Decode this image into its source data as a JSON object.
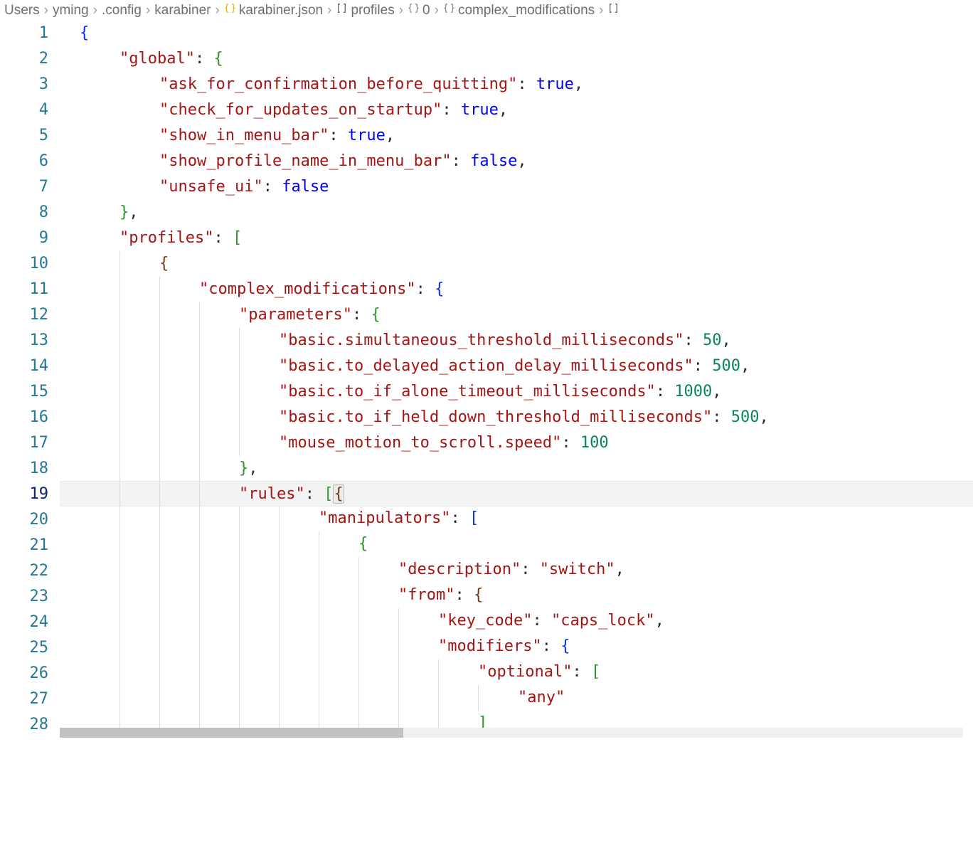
{
  "breadcrumb": [
    {
      "label": "Users",
      "icon": null
    },
    {
      "label": "yming",
      "icon": null
    },
    {
      "label": ".config",
      "icon": null
    },
    {
      "label": "karabiner",
      "icon": null
    },
    {
      "label": "karabiner.json",
      "icon": "braces-orange"
    },
    {
      "label": "profiles",
      "icon": "brackets"
    },
    {
      "label": "0",
      "icon": "braces-gray"
    },
    {
      "label": "complex_modifications",
      "icon": "braces-gray"
    },
    {
      "label": "",
      "icon": "brackets"
    }
  ],
  "active_line": 19,
  "lines": [
    {
      "n": 1,
      "indent": 0,
      "guides": [],
      "tokens": [
        [
          "bracket-b",
          "{"
        ]
      ]
    },
    {
      "n": 2,
      "indent": 1,
      "guides": [],
      "tokens": [
        [
          "key",
          "\"global\""
        ],
        [
          "punct",
          ": "
        ],
        [
          "bracket-g",
          "{"
        ]
      ]
    },
    {
      "n": 3,
      "indent": 2,
      "guides": [],
      "tokens": [
        [
          "key",
          "\"ask_for_confirmation_before_quitting\""
        ],
        [
          "punct",
          ": "
        ],
        [
          "bool",
          "true"
        ],
        [
          "punct",
          ","
        ]
      ]
    },
    {
      "n": 4,
      "indent": 2,
      "guides": [],
      "tokens": [
        [
          "key",
          "\"check_for_updates_on_startup\""
        ],
        [
          "punct",
          ": "
        ],
        [
          "bool",
          "true"
        ],
        [
          "punct",
          ","
        ]
      ]
    },
    {
      "n": 5,
      "indent": 2,
      "guides": [],
      "tokens": [
        [
          "key",
          "\"show_in_menu_bar\""
        ],
        [
          "punct",
          ": "
        ],
        [
          "bool",
          "true"
        ],
        [
          "punct",
          ","
        ]
      ]
    },
    {
      "n": 6,
      "indent": 2,
      "guides": [],
      "tokens": [
        [
          "key",
          "\"show_profile_name_in_menu_bar\""
        ],
        [
          "punct",
          ": "
        ],
        [
          "bool",
          "false"
        ],
        [
          "punct",
          ","
        ]
      ]
    },
    {
      "n": 7,
      "indent": 2,
      "guides": [],
      "tokens": [
        [
          "key",
          "\"unsafe_ui\""
        ],
        [
          "punct",
          ": "
        ],
        [
          "bool",
          "false"
        ]
      ]
    },
    {
      "n": 8,
      "indent": 1,
      "guides": [],
      "tokens": [
        [
          "bracket-g",
          "}"
        ],
        [
          "punct",
          ","
        ]
      ]
    },
    {
      "n": 9,
      "indent": 1,
      "guides": [],
      "tokens": [
        [
          "key",
          "\"profiles\""
        ],
        [
          "punct",
          ": "
        ],
        [
          "bracket-g",
          "["
        ]
      ]
    },
    {
      "n": 10,
      "indent": 2,
      "guides": [
        1
      ],
      "tokens": [
        [
          "bracket-y",
          "{"
        ]
      ]
    },
    {
      "n": 11,
      "indent": 3,
      "guides": [
        1,
        2
      ],
      "tokens": [
        [
          "key",
          "\"complex_modifications\""
        ],
        [
          "punct",
          ": "
        ],
        [
          "bracket-b",
          "{"
        ]
      ]
    },
    {
      "n": 12,
      "indent": 4,
      "guides": [
        1,
        2,
        3
      ],
      "tokens": [
        [
          "key",
          "\"parameters\""
        ],
        [
          "punct",
          ": "
        ],
        [
          "bracket-g",
          "{"
        ]
      ]
    },
    {
      "n": 13,
      "indent": 5,
      "guides": [
        1,
        2,
        3,
        4
      ],
      "tokens": [
        [
          "key",
          "\"basic.simultaneous_threshold_milliseconds\""
        ],
        [
          "punct",
          ": "
        ],
        [
          "num",
          "50"
        ],
        [
          "punct",
          ","
        ]
      ]
    },
    {
      "n": 14,
      "indent": 5,
      "guides": [
        1,
        2,
        3,
        4
      ],
      "tokens": [
        [
          "key",
          "\"basic.to_delayed_action_delay_milliseconds\""
        ],
        [
          "punct",
          ": "
        ],
        [
          "num",
          "500"
        ],
        [
          "punct",
          ","
        ]
      ]
    },
    {
      "n": 15,
      "indent": 5,
      "guides": [
        1,
        2,
        3,
        4
      ],
      "tokens": [
        [
          "key",
          "\"basic.to_if_alone_timeout_milliseconds\""
        ],
        [
          "punct",
          ": "
        ],
        [
          "num",
          "1000"
        ],
        [
          "punct",
          ","
        ]
      ]
    },
    {
      "n": 16,
      "indent": 5,
      "guides": [
        1,
        2,
        3,
        4
      ],
      "tokens": [
        [
          "key",
          "\"basic.to_if_held_down_threshold_milliseconds\""
        ],
        [
          "punct",
          ": "
        ],
        [
          "num",
          "500"
        ],
        [
          "punct",
          ","
        ]
      ]
    },
    {
      "n": 17,
      "indent": 5,
      "guides": [
        1,
        2,
        3,
        4
      ],
      "tokens": [
        [
          "key",
          "\"mouse_motion_to_scroll.speed\""
        ],
        [
          "punct",
          ": "
        ],
        [
          "num",
          "100"
        ]
      ]
    },
    {
      "n": 18,
      "indent": 4,
      "guides": [
        1,
        2,
        3
      ],
      "tokens": [
        [
          "bracket-g",
          "}"
        ],
        [
          "punct",
          ","
        ]
      ]
    },
    {
      "n": 19,
      "indent": 4,
      "guides": [
        1,
        2,
        3
      ],
      "tokens": [
        [
          "key",
          "\"rules\""
        ],
        [
          "punct",
          ": "
        ],
        [
          "bracket-g",
          "["
        ],
        [
          "bracket-y-match",
          "{"
        ]
      ]
    },
    {
      "n": 20,
      "indent": 6,
      "guides": [
        1,
        2,
        3,
        4,
        5
      ],
      "tokens": [
        [
          "key",
          "\"manipulators\""
        ],
        [
          "punct",
          ": "
        ],
        [
          "bracket-b",
          "["
        ]
      ]
    },
    {
      "n": 21,
      "indent": 7,
      "guides": [
        1,
        2,
        3,
        4,
        5,
        6
      ],
      "tokens": [
        [
          "bracket-g",
          "{"
        ]
      ]
    },
    {
      "n": 22,
      "indent": 8,
      "guides": [
        1,
        2,
        3,
        4,
        5,
        6,
        7
      ],
      "tokens": [
        [
          "key",
          "\"description\""
        ],
        [
          "punct",
          ": "
        ],
        [
          "str",
          "\"switch\""
        ],
        [
          "punct",
          ","
        ]
      ]
    },
    {
      "n": 23,
      "indent": 8,
      "guides": [
        1,
        2,
        3,
        4,
        5,
        6,
        7
      ],
      "tokens": [
        [
          "key",
          "\"from\""
        ],
        [
          "punct",
          ": "
        ],
        [
          "bracket-y",
          "{"
        ]
      ]
    },
    {
      "n": 24,
      "indent": 9,
      "guides": [
        1,
        2,
        3,
        4,
        5,
        6,
        7,
        8
      ],
      "tokens": [
        [
          "key",
          "\"key_code\""
        ],
        [
          "punct",
          ": "
        ],
        [
          "str",
          "\"caps_lock\""
        ],
        [
          "punct",
          ","
        ]
      ]
    },
    {
      "n": 25,
      "indent": 9,
      "guides": [
        1,
        2,
        3,
        4,
        5,
        6,
        7,
        8
      ],
      "tokens": [
        [
          "key",
          "\"modifiers\""
        ],
        [
          "punct",
          ": "
        ],
        [
          "bracket-b",
          "{"
        ]
      ]
    },
    {
      "n": 26,
      "indent": 10,
      "guides": [
        1,
        2,
        3,
        4,
        5,
        6,
        7,
        8,
        9
      ],
      "tokens": [
        [
          "key",
          "\"optional\""
        ],
        [
          "punct",
          ": "
        ],
        [
          "bracket-g",
          "["
        ]
      ]
    },
    {
      "n": 27,
      "indent": 11,
      "guides": [
        1,
        2,
        3,
        4,
        5,
        6,
        7,
        8,
        9,
        10
      ],
      "tokens": [
        [
          "str",
          "\"any\""
        ]
      ]
    },
    {
      "n": 28,
      "indent": 10,
      "guides": [
        1,
        2,
        3,
        4,
        5,
        6,
        7,
        8,
        9
      ],
      "tokens": [
        [
          "bracket-g",
          "]"
        ]
      ]
    }
  ]
}
